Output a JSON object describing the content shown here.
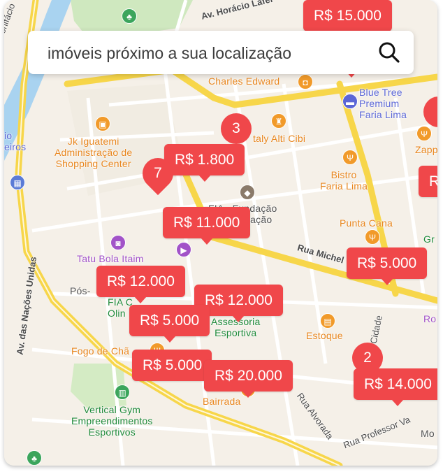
{
  "search": {
    "placeholder": "imóveis próximo a sua localização",
    "icon": "search-icon"
  },
  "places": {
    "charles_edward": "Charles Edward",
    "blue_tree_1": "Blue Tree",
    "blue_tree_2": "Premium",
    "blue_tree_3": "Faria Lima",
    "taly_alti_cibi": "taly Alti Cibi",
    "zapp": "Zapp",
    "jk_iguatemi_1": "Jk Iguatemi",
    "jk_iguatemi_2": "Administração de",
    "jk_iguatemi_3": "Shopping Center",
    "bistro_1": "Bistro",
    "bistro_2": "Faria Lima",
    "fia_1": "FIA - Fundação",
    "fia_3": "Administração",
    "punta_cana": "Punta Cana",
    "tatu_bola": "Tatu Bola Itaim",
    "pos": "Pós-",
    "fia_left": "FIA C",
    "olin": "Olin",
    "assessoria_1": "Assessoria",
    "assessoria_2": "Esportiva",
    "estoque": "Estoque",
    "fogo_de_chao": "Fogo de Chã",
    "vertical_gym_1": "Vertical Gym",
    "vertical_gym_2": "Empreendimentos",
    "vertical_gym_3": "Esportivos",
    "bairrada": "Bairrada",
    "gr": "Gr",
    "ro": "Ro",
    "mo": "Mo",
    "io": "io",
    "eiros": "eiros",
    "bonifacio": "onifácio"
  },
  "streets": {
    "horacio_lafer": "Av. Horácio Lafer",
    "nacoes_unidas": "Av. das Nações Unidas",
    "rua_michel": "Rua Michel",
    "cidade": "Cidade",
    "rua_alvorada": "Rua Alvorada",
    "rua_professor": "Rua Professor Va"
  },
  "markers": [
    {
      "label": "R$ 15.000"
    },
    {
      "label": "R$ 1.800"
    },
    {
      "label": "R$ 11.000"
    },
    {
      "label": "R$ 5.000"
    },
    {
      "label": "R$ 12.000"
    },
    {
      "label": "R$ 12.000"
    },
    {
      "label": "R$ 5.000"
    },
    {
      "label": "R$ 5.000"
    },
    {
      "label": "R$ 20.000"
    },
    {
      "label": "R$ 14.000"
    },
    {
      "label": "R$"
    }
  ],
  "clusters": [
    {
      "label": "3"
    },
    {
      "label": "7"
    },
    {
      "label": "2"
    }
  ],
  "colors": {
    "marker": "#f0474a",
    "map_background": "#f5f0e8",
    "highway": "#f7d64a",
    "water": "#a9d3f0",
    "park": "#cfe8bf"
  }
}
